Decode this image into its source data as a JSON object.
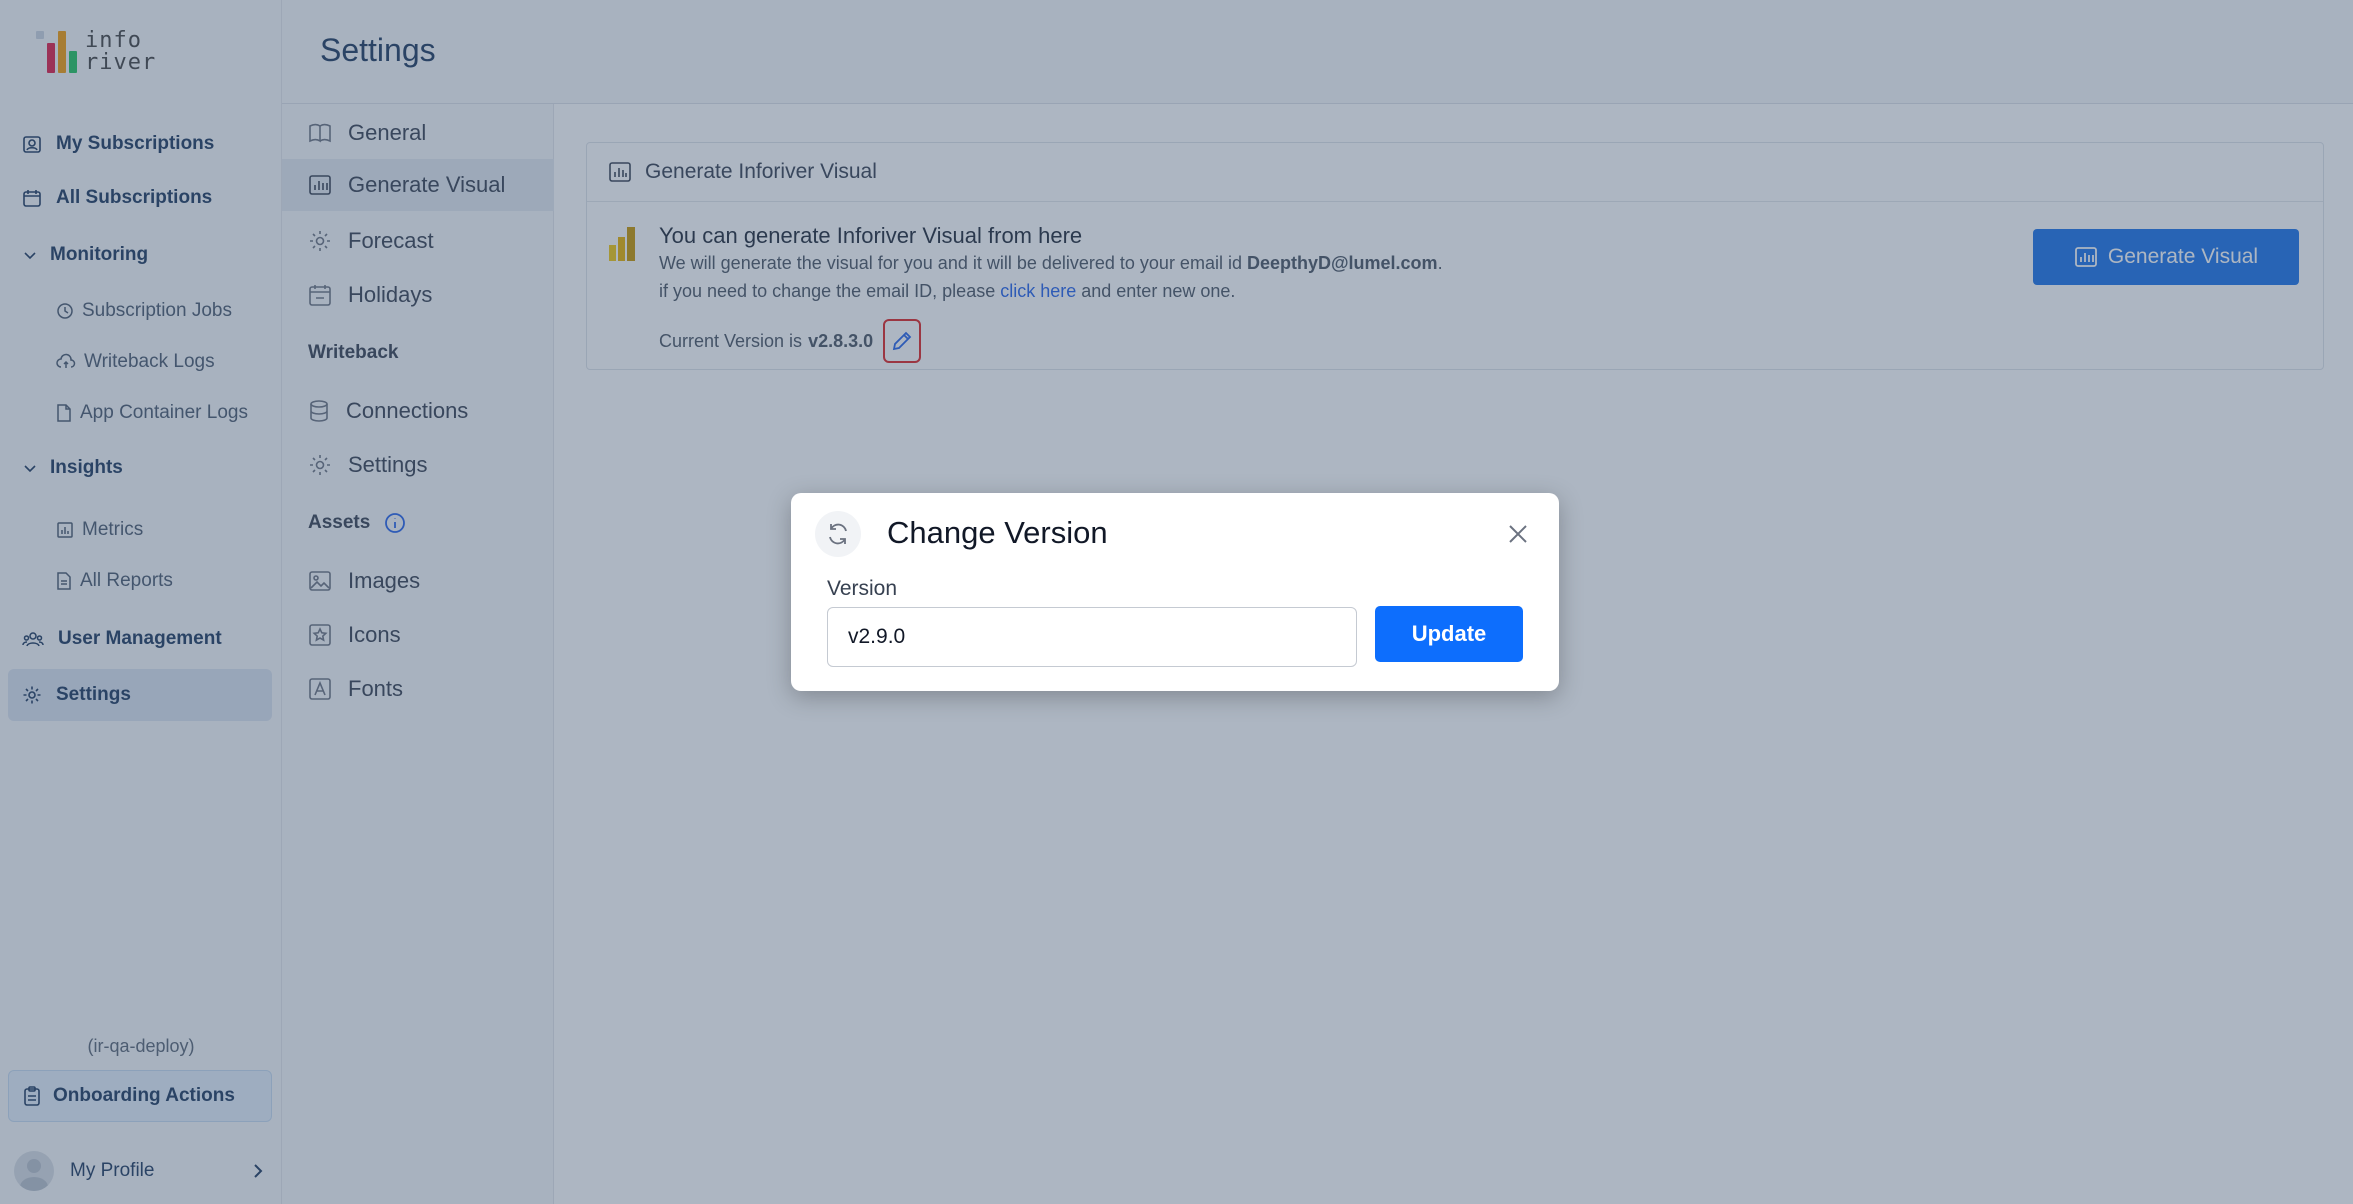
{
  "app": {
    "logo_text": "info river",
    "brand_colors": [
      "#e11d48",
      "#f59e0b",
      "#22c55e"
    ]
  },
  "sidebar": {
    "items": [
      {
        "label": "My Subscriptions",
        "icon": "user-badge-icon"
      },
      {
        "label": "All Subscriptions",
        "icon": "calendar-icon"
      }
    ],
    "monitoring": {
      "label": "Monitoring",
      "items": [
        {
          "label": "Subscription Jobs",
          "icon": "clock-icon"
        },
        {
          "label": "Writeback Logs",
          "icon": "cloud-upload-icon"
        },
        {
          "label": "App Container Logs",
          "icon": "file-icon"
        }
      ]
    },
    "insights": {
      "label": "Insights",
      "items": [
        {
          "label": "Metrics",
          "icon": "chart-icon"
        },
        {
          "label": "All Reports",
          "icon": "report-icon"
        }
      ]
    },
    "user_management": "User Management",
    "settings": "Settings",
    "env": "(ir-qa-deploy)",
    "onboarding": "Onboarding Actions",
    "profile": "My Profile"
  },
  "header": {
    "title": "Settings"
  },
  "settings_menu": {
    "items": [
      {
        "label": "General",
        "icon": "book-icon"
      },
      {
        "label": "Generate Visual",
        "icon": "bar-chart-icon"
      },
      {
        "label": "Forecast",
        "icon": "gear-icon"
      },
      {
        "label": "Holidays",
        "icon": "calendar-icon"
      }
    ],
    "writeback_label": "Writeback",
    "writeback_items": [
      {
        "label": "Connections",
        "icon": "database-icon"
      },
      {
        "label": "Settings",
        "icon": "gear-icon"
      }
    ],
    "assets_label": "Assets",
    "assets_items": [
      {
        "label": "Images",
        "icon": "image-icon"
      },
      {
        "label": "Icons",
        "icon": "star-icon"
      },
      {
        "label": "Fonts",
        "icon": "font-icon"
      }
    ]
  },
  "panel": {
    "header": "Generate Inforiver Visual",
    "title": "You can generate Inforiver Visual from here",
    "line1_prefix": "We will generate the visual for you and it will be delivered to your email id ",
    "email": "DeepthyD@lumel.com",
    "line1_suffix": ".",
    "line2_prefix": "if you need to change the email ID, please ",
    "link": "click here",
    "line2_suffix": " and enter new one.",
    "version_prefix": "Current Version is ",
    "version": "v2.8.3.0",
    "button": "Generate Visual"
  },
  "modal": {
    "title": "Change Version",
    "label": "Version",
    "value": "v2.9.0",
    "button": "Update"
  }
}
